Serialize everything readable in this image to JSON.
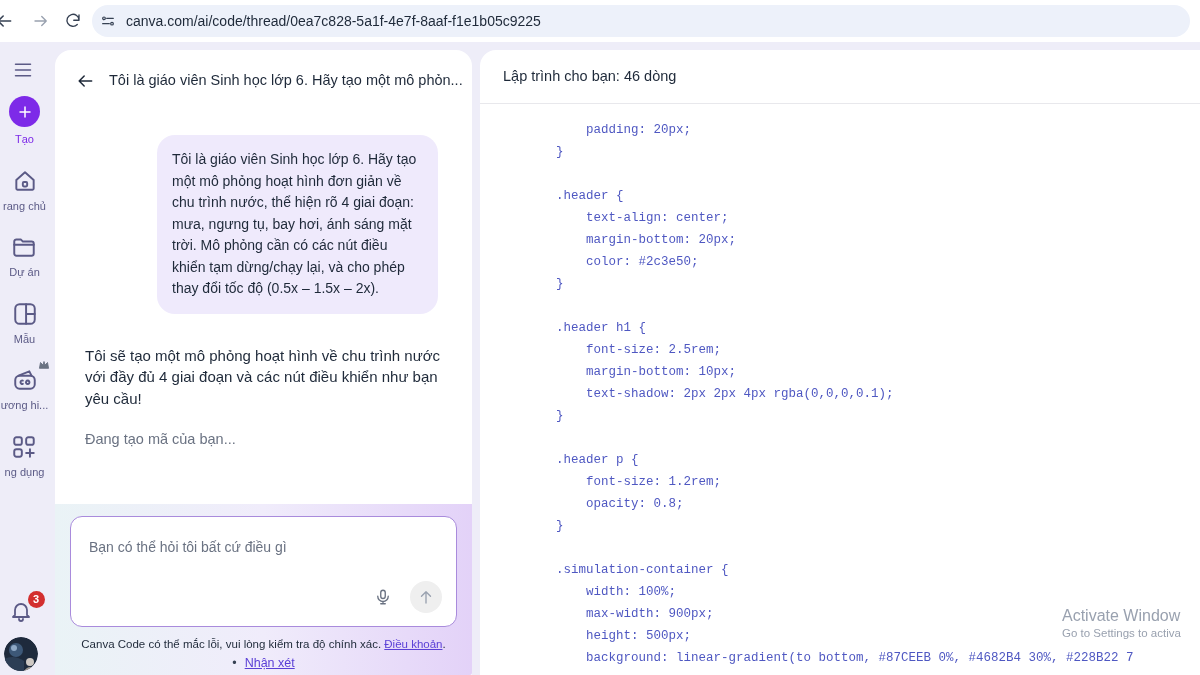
{
  "browser": {
    "url": "canva.com/ai/code/thread/0ea7c828-5a1f-4e7f-8aaf-f1e1b05c9225"
  },
  "rail": {
    "items": [
      {
        "kind": "create",
        "label": "Tạo",
        "selected": true
      },
      {
        "kind": "home",
        "label": "rang chủ",
        "selected": false
      },
      {
        "kind": "folder",
        "label": "Dự án",
        "selected": false
      },
      {
        "kind": "template",
        "label": "Mẫu",
        "selected": false
      },
      {
        "kind": "brand",
        "label": "ương hi...",
        "selected": false
      },
      {
        "kind": "apps",
        "label": "ng dụng",
        "selected": false
      }
    ],
    "notification_count": "3"
  },
  "chat": {
    "title": "Tôi là giáo viên Sinh học lớp 6. Hãy tạo một mô phỏn...",
    "user_message": "Tôi là giáo viên Sinh học lớp 6. Hãy tạo một mô phỏng hoạt hình đơn giản về chu trình nước, thể hiện rõ 4 giai đoạn: mưa, ngưng tụ, bay hơi, ánh sáng mặt trời. Mô phỏng cần có các nút điều khiển tạm dừng/chạy lại, và cho phép thay đổi tốc độ (0.5x – 1.5x – 2x).",
    "assistant_message": "Tôi sẽ tạo một mô phỏng hoạt hình về chu trình nước với đầy đủ 4 giai đoạn và các nút điều khiển như bạn yêu cầu!",
    "status": "Đang tạo mã của bạn...",
    "input": {
      "placeholder": "Bạn có thể hỏi tôi bất cứ điều gì"
    },
    "disclaimer": {
      "text": "Canva Code có thể mắc lỗi, vui lòng kiểm tra độ chính xác.",
      "link": "Điều khoản",
      "end": "."
    },
    "feedback": {
      "bullet": "•",
      "link": "Nhận xét"
    }
  },
  "code": {
    "header": "Lập trình cho bạn: 46 dòng",
    "lines": [
      {
        "kind": "code",
        "text": "        padding: 20px;"
      },
      {
        "kind": "code",
        "text": "    }"
      },
      {
        "kind": "blank"
      },
      {
        "kind": "code",
        "text": "    .header {"
      },
      {
        "kind": "code",
        "text": "        text-align: center;"
      },
      {
        "kind": "code",
        "text": "        margin-bottom: 20px;"
      },
      {
        "kind": "code",
        "text": "        color: #2c3e50;"
      },
      {
        "kind": "code",
        "text": "    }"
      },
      {
        "kind": "blank"
      },
      {
        "kind": "code",
        "text": "    .header h1 {"
      },
      {
        "kind": "code",
        "text": "        font-size: 2.5rem;"
      },
      {
        "kind": "code",
        "text": "        margin-bottom: 10px;"
      },
      {
        "kind": "code",
        "text": "        text-shadow: 2px 2px 4px rgba(0,0,0,0.1);"
      },
      {
        "kind": "code",
        "text": "    }"
      },
      {
        "kind": "blank"
      },
      {
        "kind": "code",
        "text": "    .header p {"
      },
      {
        "kind": "code",
        "text": "        font-size: 1.2rem;"
      },
      {
        "kind": "code",
        "text": "        opacity: 0.8;"
      },
      {
        "kind": "code",
        "text": "    }"
      },
      {
        "kind": "blank"
      },
      {
        "kind": "code",
        "text": "    .simulation-container {"
      },
      {
        "kind": "code",
        "text": "        width: 100%;"
      },
      {
        "kind": "code",
        "text": "        max-width: 900px;"
      },
      {
        "kind": "code",
        "text": "        height: 500px;"
      },
      {
        "kind": "code",
        "text": "        background: linear-gradient(to bottom, #87CEEB 0%, #4682B4 30%, #228B22 7"
      }
    ]
  },
  "os_overlay": {
    "title": "Activate Window",
    "subtitle": "Go to Settings to activa"
  }
}
